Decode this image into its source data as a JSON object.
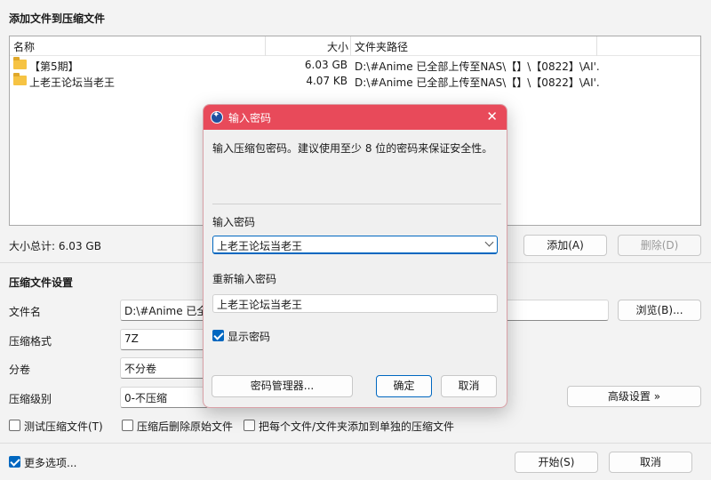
{
  "window": {
    "title": "添加文件到压缩文件"
  },
  "filelist": {
    "columns": {
      "name": "名称",
      "size": "大小",
      "path": "文件夹路径"
    },
    "rows": [
      {
        "name": "【第5期】",
        "size": "6.03 GB",
        "path": "D:\\#Anime 已全部上传至NAS\\【】\\【0822】\\AI'..."
      },
      {
        "name": "上老王论坛当老王",
        "size": "4.07 KB",
        "path": "D:\\#Anime 已全部上传至NAS\\【】\\【0822】\\AI'..."
      }
    ]
  },
  "summary": {
    "total": "大小总计: 6.03 GB",
    "add_label": "添加(A)",
    "delete_label": "删除(D)"
  },
  "settings": {
    "title": "压缩文件设置",
    "filename_label": "文件名",
    "filename_value": "D:\\#Anime 已全部",
    "browse_label": "浏览(B)...",
    "format_label": "压缩格式",
    "format_value": "7Z",
    "volume_label": "分卷",
    "volume_value": "不分卷",
    "level_label": "压缩级别",
    "level_value": "0-不压缩",
    "advanced_label": "高级设置 »",
    "test_label": "测试压缩文件(T)",
    "delete_after_label": "压缩后删除原始文件",
    "separate_label": "把每个文件/文件夹添加到单独的压缩文件",
    "more_options_label": "更多选项...",
    "start_label": "开始(S)",
    "cancel_label": "取消"
  },
  "dialog": {
    "title": "输入密码",
    "description": "输入压缩包密码。建议使用至少 8 位的密码来保证安全性。",
    "password_label": "输入密码",
    "password_value": "上老王论坛当老王",
    "confirm_label": "重新输入密码",
    "confirm_value": "上老王论坛当老王",
    "show_password_label": "显示密码",
    "manager_label": "密码管理器...",
    "ok_label": "确定",
    "cancel_label": "取消"
  },
  "colors": {
    "accent": "#0067c0",
    "dialog_title": "#e84a5a",
    "folder": "#f6c343"
  }
}
